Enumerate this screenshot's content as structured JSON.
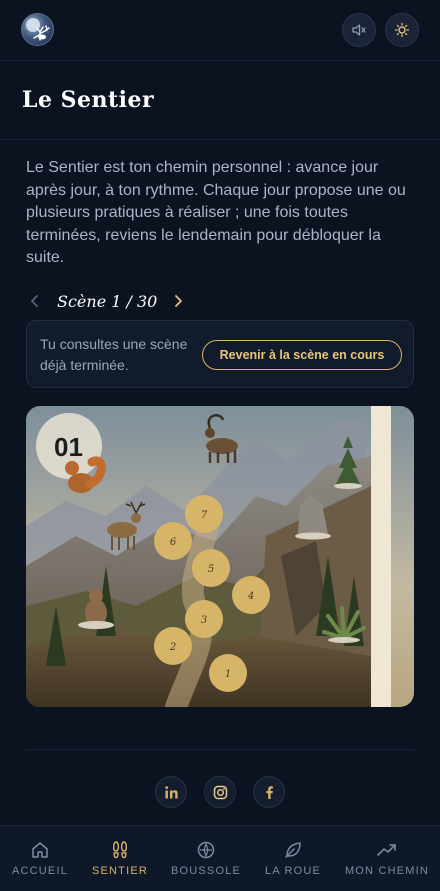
{
  "header": {
    "logo_icon": "stag-moon-logo",
    "mute_icon": "speaker-muted-icon",
    "theme_icon": "sun-icon"
  },
  "page": {
    "title": "Le Sentier",
    "intro": "Le Sentier est ton chemin personnel : avance jour après jour, à ton rythme. Chaque jour propose une ou plusieurs pratiques à réaliser ; une fois toutes terminées, reviens le lendemain pour débloquer la suite."
  },
  "scene_nav": {
    "label": "Scène 1 / 30",
    "prev_icon": "chevron-left-icon",
    "next_icon": "chevron-right-icon"
  },
  "notice": {
    "text": "Tu consultes une scène déjà terminée.",
    "button": "Revenir à la scène en cours"
  },
  "scene": {
    "badge": "01",
    "steps": [
      "1",
      "2",
      "3",
      "4",
      "5",
      "6",
      "7"
    ],
    "animals": [
      "squirrel",
      "ibex",
      "deer",
      "marmot"
    ],
    "accent": "#d9b36a"
  },
  "socials": [
    "linkedin-icon",
    "instagram-icon",
    "facebook-icon"
  ],
  "bottom_nav": {
    "items": [
      {
        "label": "ACCUEIL",
        "icon": "home-icon"
      },
      {
        "label": "SENTIER",
        "icon": "footprints-icon",
        "active": true
      },
      {
        "label": "BOUSSOLE",
        "icon": "compass-icon"
      },
      {
        "label": "LA ROUE",
        "icon": "leaf-icon"
      },
      {
        "label": "MON CHEMIN",
        "icon": "trend-up-icon"
      }
    ]
  }
}
